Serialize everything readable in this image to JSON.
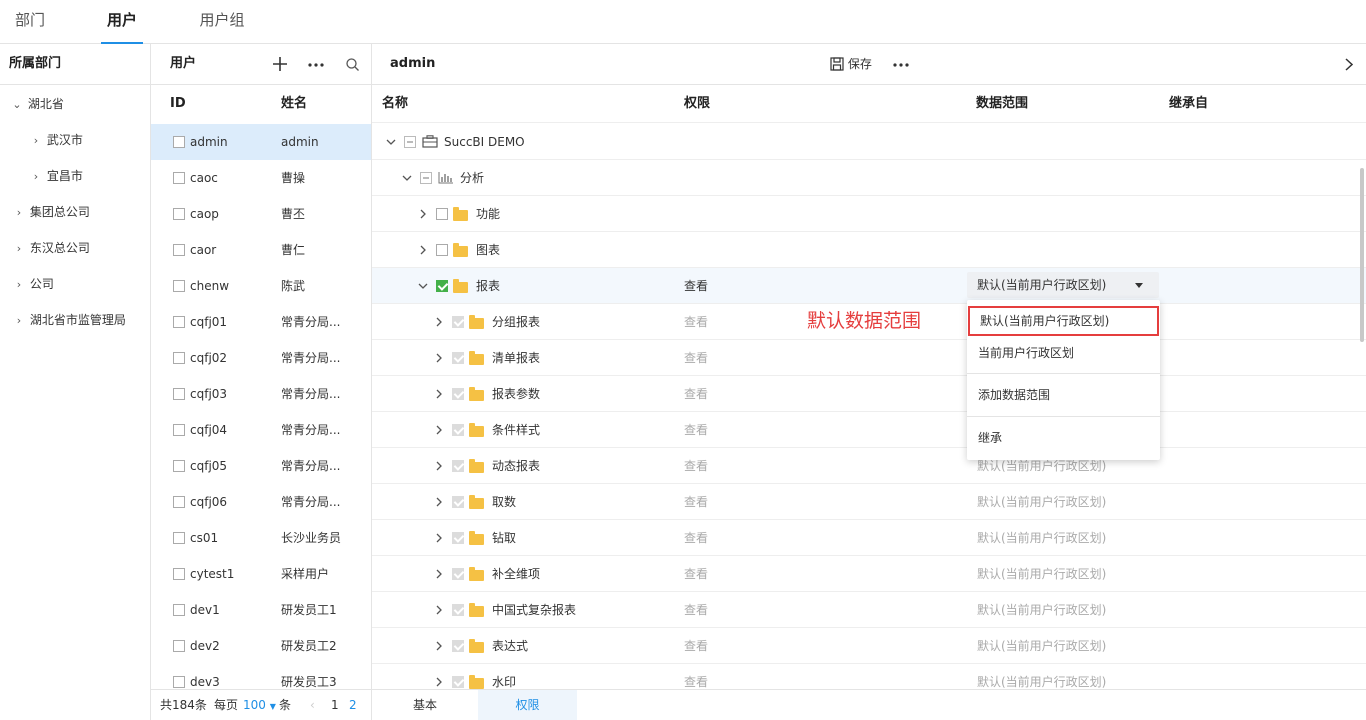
{
  "top_tabs": [
    "部门",
    "用户",
    "用户组"
  ],
  "dept": {
    "header": "所属部门",
    "items": [
      "湖北省",
      "武汉市",
      "宜昌市",
      "集团总公司",
      "东汉总公司",
      "公司",
      "湖北省市监管理局"
    ]
  },
  "users": {
    "header": "用户",
    "col_id": "ID",
    "col_name": "姓名",
    "rows": [
      {
        "id": "admin",
        "name": "admin"
      },
      {
        "id": "caoc",
        "name": "曹操"
      },
      {
        "id": "caop",
        "name": "曹丕"
      },
      {
        "id": "caor",
        "name": "曹仁"
      },
      {
        "id": "chenw",
        "name": "陈武"
      },
      {
        "id": "cqfj01",
        "name": "常青分局..."
      },
      {
        "id": "cqfj02",
        "name": "常青分局..."
      },
      {
        "id": "cqfj03",
        "name": "常青分局..."
      },
      {
        "id": "cqfj04",
        "name": "常青分局..."
      },
      {
        "id": "cqfj05",
        "name": "常青分局..."
      },
      {
        "id": "cqfj06",
        "name": "常青分局..."
      },
      {
        "id": "cs01",
        "name": "长沙业务员"
      },
      {
        "id": "cytest1",
        "name": "采样用户"
      },
      {
        "id": "dev1",
        "name": "研发员工1"
      },
      {
        "id": "dev2",
        "name": "研发员工2"
      },
      {
        "id": "dev3",
        "name": "研发员工3"
      }
    ],
    "footer": {
      "total": "共184条",
      "per_page_label": "每页",
      "per_page": "100",
      "unit": "条",
      "page1": "1",
      "page2": "2"
    }
  },
  "main": {
    "title": "admin",
    "save": "保存",
    "col_name": "名称",
    "col_perm": "权限",
    "col_scope": "数据范围",
    "col_inherit": "继承自",
    "tree": [
      {
        "label": "SuccBI DEMO",
        "perm": "",
        "scope": ""
      },
      {
        "label": "分析",
        "perm": "",
        "scope": ""
      },
      {
        "label": "功能",
        "perm": "",
        "scope": ""
      },
      {
        "label": "图表",
        "perm": "",
        "scope": ""
      },
      {
        "label": "报表",
        "perm": "查看",
        "scope": ""
      },
      {
        "label": "分组报表",
        "perm": "查看",
        "scope": ""
      },
      {
        "label": "清单报表",
        "perm": "查看",
        "scope": ""
      },
      {
        "label": "报表参数",
        "perm": "查看",
        "scope": ""
      },
      {
        "label": "条件样式",
        "perm": "查看",
        "scope": ""
      },
      {
        "label": "动态报表",
        "perm": "查看",
        "scope": "默认(当前用户行政区划)"
      },
      {
        "label": "取数",
        "perm": "查看",
        "scope": "默认(当前用户行政区划)"
      },
      {
        "label": "钻取",
        "perm": "查看",
        "scope": "默认(当前用户行政区划)"
      },
      {
        "label": "补全维项",
        "perm": "查看",
        "scope": "默认(当前用户行政区划)"
      },
      {
        "label": "中国式复杂报表",
        "perm": "查看",
        "scope": "默认(当前用户行政区划)"
      },
      {
        "label": "表达式",
        "perm": "查看",
        "scope": "默认(当前用户行政区划)"
      },
      {
        "label": "水印",
        "perm": "查看",
        "scope": "默认(当前用户行政区划)"
      }
    ],
    "dropdown_value": "默认(当前用户行政区划)",
    "menu": [
      "默认(当前用户行政区划)",
      "当前用户行政区划",
      "添加数据范围",
      "继承"
    ],
    "annotation": "默认数据范围",
    "bottom_tabs": [
      "基本",
      "权限"
    ]
  },
  "colors": {
    "accent": "#1f8fe5",
    "check": "#43b049",
    "folder": "#f5c144",
    "annotation": "#e53e3e"
  }
}
